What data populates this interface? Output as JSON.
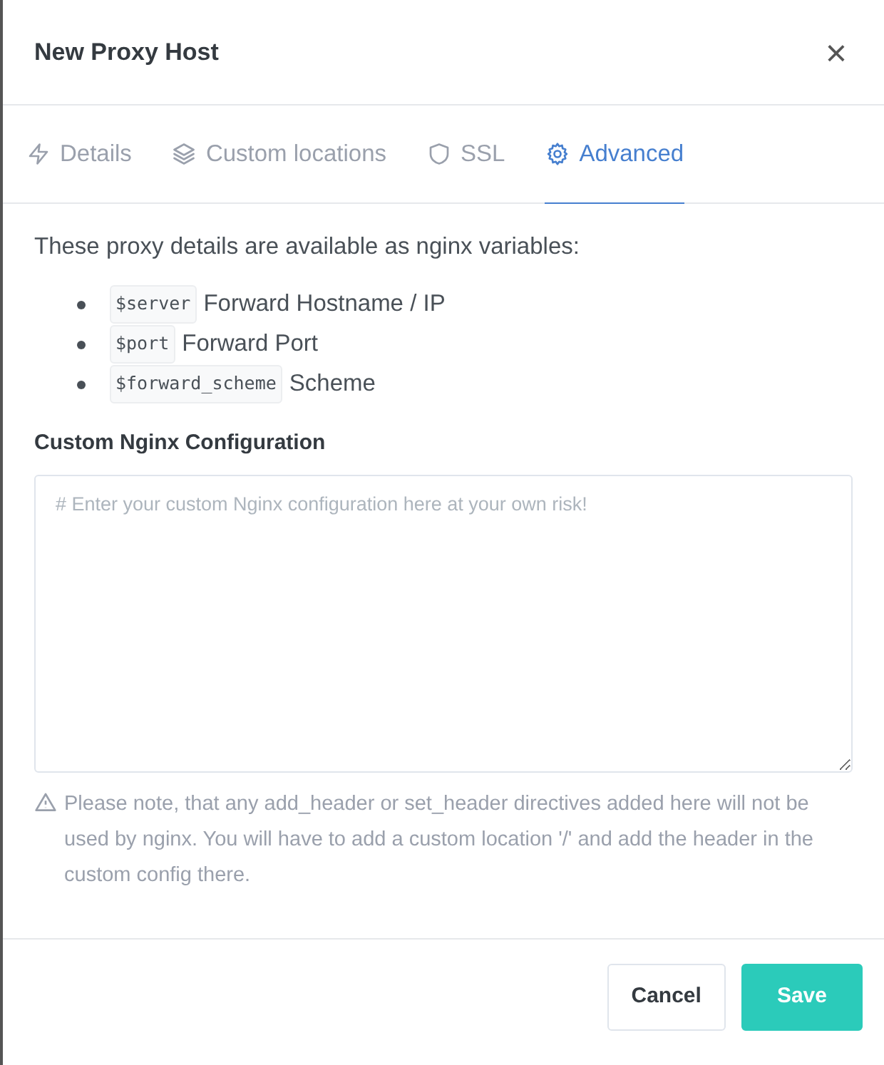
{
  "modal": {
    "title": "New Proxy Host",
    "close": "×"
  },
  "tabs": [
    {
      "label": "Details",
      "kind": "bolt",
      "selected": false
    },
    {
      "label": "Custom locations",
      "kind": "layers",
      "selected": false
    },
    {
      "label": "SSL",
      "kind": "shield",
      "selected": false
    },
    {
      "label": "Advanced",
      "kind": "gear",
      "selected": true
    }
  ],
  "intro": "These proxy details are available as nginx variables:",
  "variables": [
    {
      "code": "$server",
      "description": "Forward Hostname / IP"
    },
    {
      "code": "$port",
      "description": "Forward Port"
    },
    {
      "code": "$forward_scheme",
      "description": "Scheme"
    }
  ],
  "config": {
    "label": "Custom Nginx Configuration",
    "placeholder": "# Enter your custom Nginx configuration here at your own risk!"
  },
  "note": "Please note, that any add_header or set_header directives added here will not be used by nginx. You will have to add a custom location '/' and add the header in the custom config there.",
  "buttons": [
    {
      "label": "Cancel",
      "kind": "secondary"
    },
    {
      "label": "Save",
      "kind": "primary"
    }
  ]
}
